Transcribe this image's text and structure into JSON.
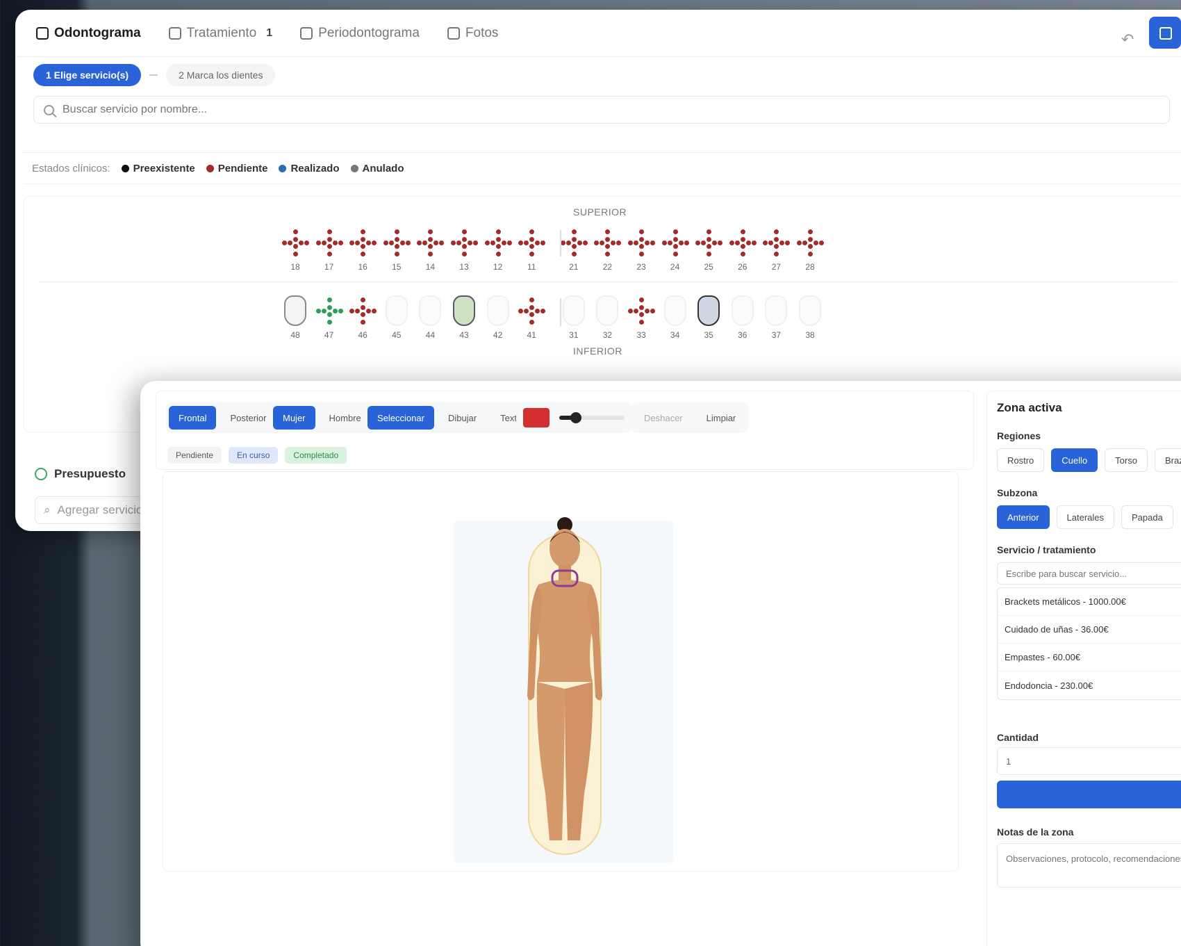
{
  "tabs": [
    {
      "label": "Odontograma",
      "active": true
    },
    {
      "label": "Tratamiento",
      "badge": "1"
    },
    {
      "label": "Periodontograma"
    },
    {
      "label": "Fotos"
    }
  ],
  "stepper": {
    "step1": "1  Elige servicio(s)",
    "step2": "2  Marca los dientes"
  },
  "search": {
    "placeholder": "Buscar servicio por nombre..."
  },
  "legend": {
    "label": "Estados clínicos:",
    "items": [
      {
        "label": "Preexistente",
        "color": "#111111"
      },
      {
        "label": "Pendiente",
        "color": "#a52a2a"
      },
      {
        "label": "Realizado",
        "color": "#2a6fb0"
      },
      {
        "label": "Anulado",
        "color": "#777777"
      }
    ]
  },
  "odontogram": {
    "upper_label": "SUPERIOR",
    "lower_label": "INFERIOR",
    "upper_teeth": [
      "18",
      "17",
      "16",
      "15",
      "14",
      "13",
      "12",
      "11",
      "21",
      "22",
      "23",
      "24",
      "25",
      "26",
      "27",
      "28"
    ],
    "lower_teeth": [
      "48",
      "47",
      "46",
      "45",
      "44",
      "43",
      "42",
      "41",
      "31",
      "32",
      "33",
      "34",
      "35",
      "36",
      "37",
      "38"
    ]
  },
  "budget": {
    "title": "Presupuesto",
    "search_placeholder": "Agregar servicio"
  },
  "editor": {
    "view_buttons": [
      "Frontal",
      "Posterior"
    ],
    "gender_buttons": [
      "Mujer",
      "Hombre"
    ],
    "tool_buttons": [
      "Seleccionar",
      "Dibujar",
      "Texto"
    ],
    "action_buttons": [
      "Deshacer",
      "Limpiar"
    ],
    "paint_color": "#d32f2f",
    "brush_level": 0.25,
    "states": [
      "Pendiente",
      "En curso",
      "Completado"
    ]
  },
  "side": {
    "title": "Zona activa",
    "regions_title": "Regiones",
    "regions": [
      "Rostro",
      "Cuello",
      "Torso",
      "Brazos"
    ],
    "subzone_title": "Subzona",
    "subzones": [
      "Anterior",
      "Laterales",
      "Papada"
    ],
    "service_title": "Servicio / tratamiento",
    "service_placeholder": "Escribe para buscar servicio...",
    "services": [
      "Brackets metálicos - 1000.00€",
      "Cuidado de uñas - 36.00€",
      "Empastes - 60.00€",
      "Endodoncia - 230.00€"
    ],
    "quantity_title": "Cantidad",
    "quantity_value": "1",
    "notes_title": "Notas de la zona",
    "notes_placeholder": "Observaciones, protocolo, recomendaciones..."
  }
}
